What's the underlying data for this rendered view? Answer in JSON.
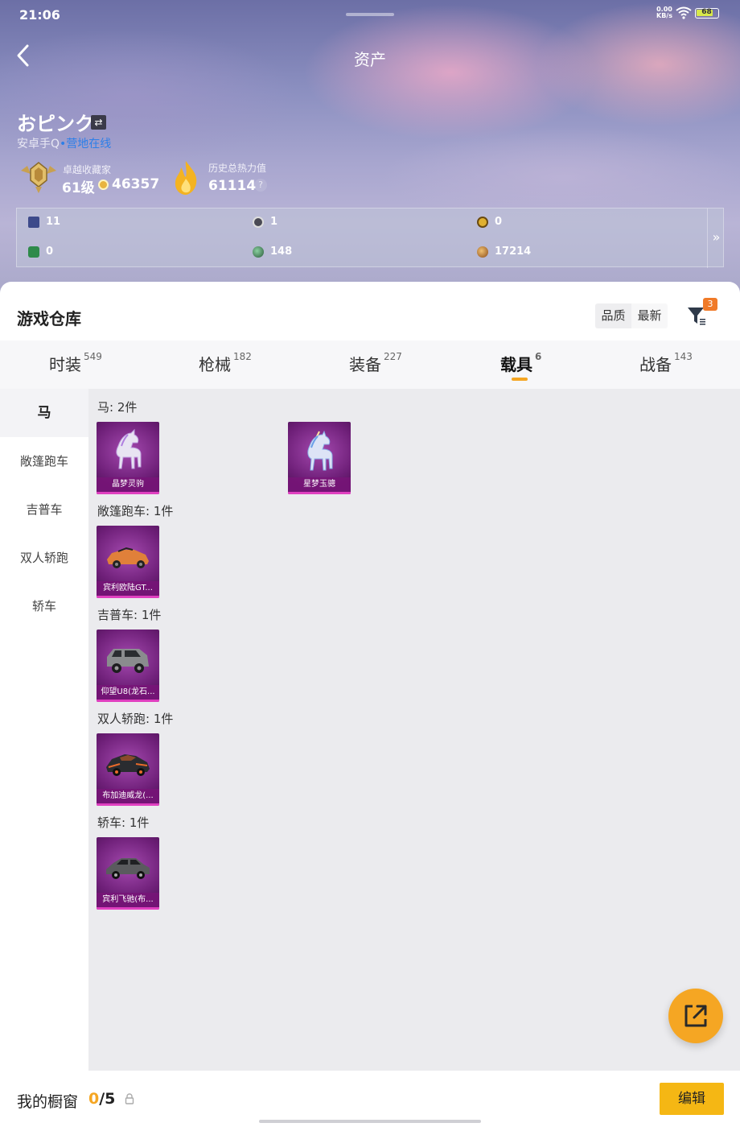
{
  "status": {
    "time": "21:06",
    "net_speed": "0.00",
    "net_unit": "KB/s",
    "battery": "68"
  },
  "header": {
    "title": "资产"
  },
  "profile": {
    "name": "おピンク",
    "platform": "安卓手Q",
    "online_status": "营地在线",
    "collector_label": "卓越收藏家",
    "collector_level": "61级",
    "collector_points": "46357",
    "heat_label": "历史总热力值",
    "heat_value": "61114",
    "help": "?"
  },
  "stats": [
    {
      "icon": "book-icon",
      "value": "11"
    },
    {
      "icon": "badge-icon",
      "value": "1"
    },
    {
      "icon": "gold-coin-icon",
      "value": "0"
    },
    {
      "icon": "green-token-icon",
      "value": "0"
    },
    {
      "icon": "globe-icon",
      "value": "148"
    },
    {
      "icon": "bronze-coin-icon",
      "value": "17214"
    }
  ],
  "warehouse": {
    "title": "游戏仓库",
    "sort_quality": "品质",
    "sort_latest": "最新",
    "filter_count": "3",
    "tabs": [
      {
        "label": "时装",
        "count": "549"
      },
      {
        "label": "枪械",
        "count": "182"
      },
      {
        "label": "装备",
        "count": "227"
      },
      {
        "label": "载具",
        "count": "6"
      },
      {
        "label": "战备",
        "count": "143"
      }
    ],
    "sidebar": [
      "马",
      "敞篷跑车",
      "吉普车",
      "双人轿跑",
      "轿车"
    ],
    "groups": [
      {
        "title": "马: 2件",
        "items": [
          "晶梦灵驹",
          "星梦玉骢"
        ]
      },
      {
        "title": "敞篷跑车: 1件",
        "items": [
          "宾利欧陆GT..."
        ]
      },
      {
        "title": "吉普车: 1件",
        "items": [
          "仰望U8(龙石..."
        ]
      },
      {
        "title": "双人轿跑: 1件",
        "items": [
          "布加迪威龙(..."
        ]
      },
      {
        "title": "轿车: 1件",
        "items": [
          "宾利飞驰(布..."
        ]
      }
    ]
  },
  "showcase": {
    "label": "我的橱窗",
    "current": "0",
    "total": "/5",
    "edit": "编辑"
  },
  "colors": {
    "accent": "#f5a623",
    "card_purple": "#6e1f78",
    "online_blue": "#2d7fe8"
  }
}
